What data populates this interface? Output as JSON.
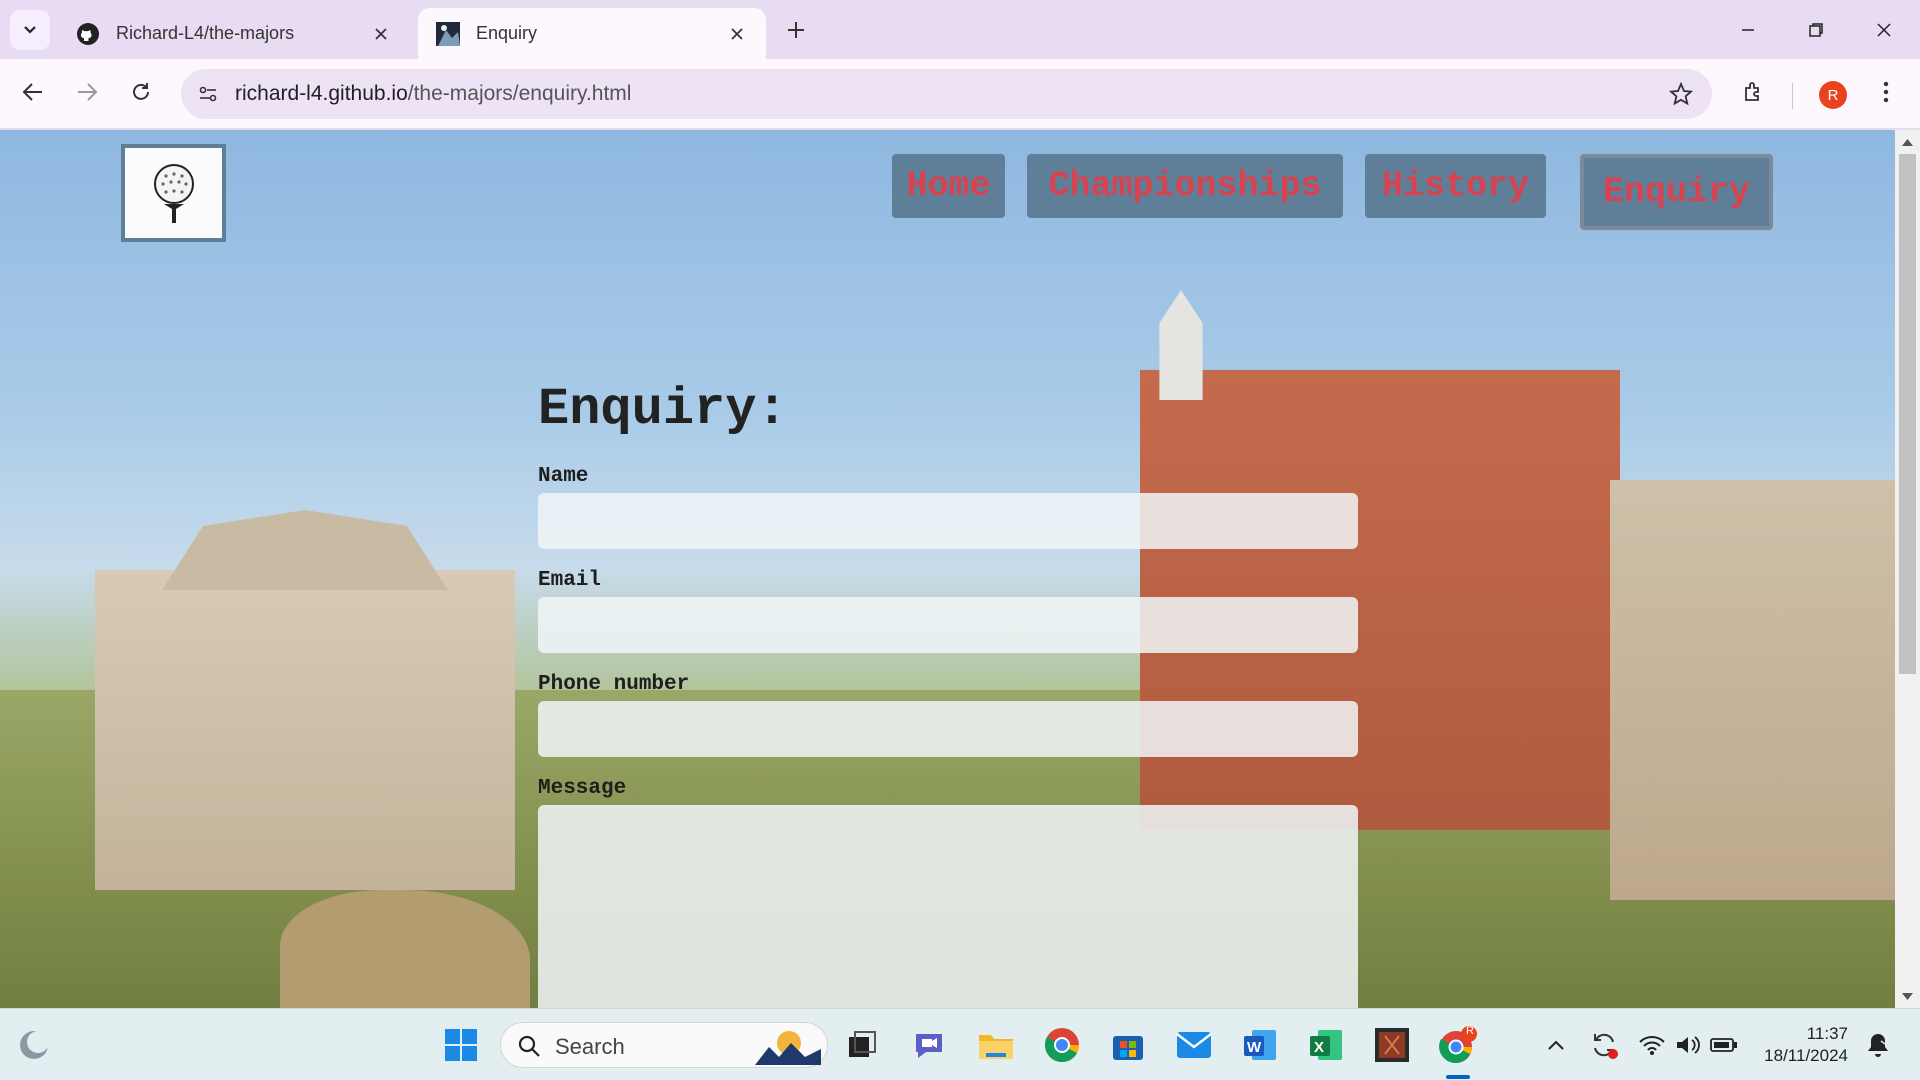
{
  "browser": {
    "tabs": [
      {
        "title": "Richard-L4/the-majors",
        "icon": "github-icon"
      },
      {
        "title": "Enquiry",
        "icon": "page-favicon-icon"
      }
    ],
    "url_host": "richard-l4.github.io",
    "url_path": "/the-majors/enquiry.html",
    "profile_initial": "R"
  },
  "page": {
    "nav": {
      "home": "Home",
      "championships": "Championships",
      "history": "History",
      "enquiry": "Enquiry"
    },
    "form": {
      "heading": "Enquiry:",
      "name_label": "Name",
      "email_label": "Email",
      "phone_label": "Phone number",
      "message_label": "Message",
      "name_value": "",
      "email_value": "",
      "phone_value": "",
      "message_value": ""
    }
  },
  "taskbar": {
    "search_label": "Search",
    "time": "11:37",
    "date": "18/11/2024",
    "chrome_badge": "R"
  },
  "colors": {
    "nav_bg": "#5f7f99",
    "nav_text": "#d8434f",
    "chrome_bg": "#e8dcf3"
  }
}
